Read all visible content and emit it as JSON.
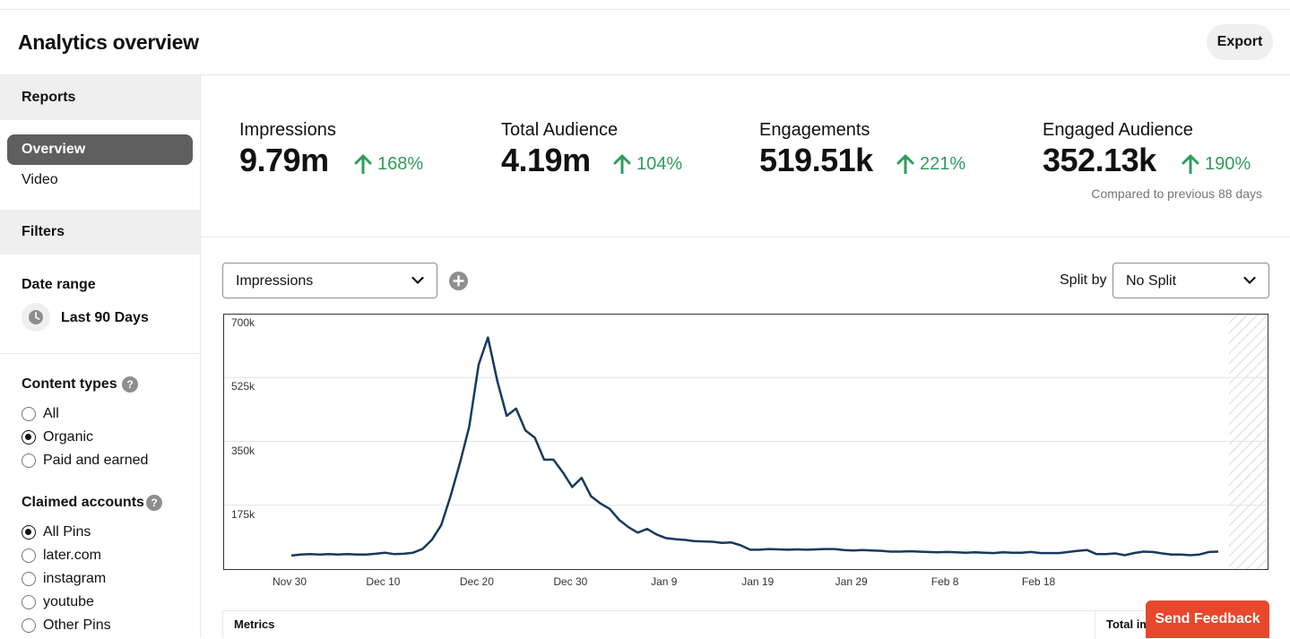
{
  "header": {
    "title": "Analytics overview",
    "export_label": "Export"
  },
  "sidebar": {
    "reports_heading": "Reports",
    "nav": [
      {
        "label": "Overview",
        "active": true
      },
      {
        "label": "Video",
        "active": false
      }
    ],
    "filters_heading": "Filters",
    "date_range": {
      "label": "Date range",
      "value": "Last 90 Days"
    },
    "content_types": {
      "label": "Content types",
      "options": [
        {
          "label": "All",
          "checked": false
        },
        {
          "label": "Organic",
          "checked": true
        },
        {
          "label": "Paid and earned",
          "checked": false
        }
      ]
    },
    "claimed_accounts": {
      "label": "Claimed accounts",
      "options": [
        {
          "label": "All Pins",
          "checked": true
        },
        {
          "label": "later.com",
          "checked": false
        },
        {
          "label": "instagram",
          "checked": false
        },
        {
          "label": "youtube",
          "checked": false
        },
        {
          "label": "Other Pins",
          "checked": false
        }
      ]
    }
  },
  "stats": [
    {
      "label": "Impressions",
      "value": "9.79m",
      "change": "168%"
    },
    {
      "label": "Total Audience",
      "value": "4.19m",
      "change": "104%"
    },
    {
      "label": "Engagements",
      "value": "519.51k",
      "change": "221%"
    },
    {
      "label": "Engaged Audience",
      "value": "352.13k",
      "change": "190%"
    }
  ],
  "compared_note": "Compared to previous 88 days",
  "controls": {
    "metric_select": "Impressions",
    "split_label": "Split by",
    "split_select": "No Split"
  },
  "colors": {
    "accent_green": "#2f9c5b",
    "line": "#173a5e",
    "feedback": "#e9472b"
  },
  "chart_data": {
    "type": "line",
    "ylim": [
      0,
      700000
    ],
    "yticks": [
      "175k",
      "350k",
      "525k",
      "700k"
    ],
    "xticks": [
      "Nov 30",
      "Dec 10",
      "Dec 20",
      "Dec 30",
      "Jan 9",
      "Jan 19",
      "Jan 29",
      "Feb 8",
      "Feb 18"
    ],
    "series": [
      {
        "values": [
          37000,
          40000,
          41000,
          40000,
          41000,
          40000,
          41000,
          40000,
          40000,
          42000,
          45000,
          41000,
          42000,
          45000,
          55000,
          80000,
          120000,
          200000,
          290000,
          390000,
          560000,
          635000,
          515000,
          420000,
          440000,
          380000,
          360000,
          300000,
          300000,
          265000,
          225000,
          250000,
          200000,
          180000,
          165000,
          135000,
          115000,
          100000,
          110000,
          95000,
          85000,
          82000,
          80000,
          77000,
          76000,
          75000,
          72000,
          73000,
          65000,
          53000,
          53000,
          55000,
          54000,
          53000,
          54000,
          53000,
          54000,
          55000,
          55000,
          52000,
          51000,
          52000,
          51000,
          50000,
          48000,
          48000,
          49000,
          48000,
          47000,
          46000,
          47000,
          46000,
          45000,
          46000,
          45000,
          44000,
          46000,
          45000,
          45000,
          47000,
          44000,
          44000,
          44000,
          47000,
          50000,
          52000,
          41000,
          41000,
          43000,
          38000,
          44000,
          48000,
          47000,
          43000,
          40000,
          40000,
          38000,
          40000,
          47000,
          48000
        ]
      }
    ]
  },
  "table": {
    "col1": "Metrics",
    "col2": "Total im"
  },
  "feedback_label": "Send Feedback"
}
